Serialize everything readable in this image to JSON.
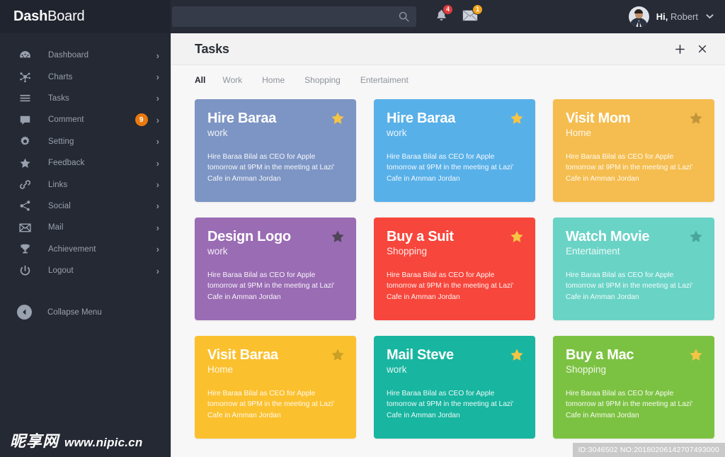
{
  "brand": {
    "bold": "Dash",
    "light": "Board"
  },
  "search": {
    "value": "",
    "placeholder": "",
    "icon": "search-icon"
  },
  "notifications": {
    "bell": {
      "icon": "bell-icon",
      "count": "4",
      "color": "#e03b3b"
    },
    "mail": {
      "icon": "envelope-icon",
      "count": "1",
      "color": "#f0a41e"
    }
  },
  "profile": {
    "greeting": "Hi,",
    "name": "Robert",
    "caret": "⌵",
    "avatar_alt": "avatar"
  },
  "sidebar": {
    "items": [
      {
        "label": "Dashboard",
        "icon": "gauge-icon",
        "chevron": "›",
        "badge": null
      },
      {
        "label": "Charts",
        "icon": "network-icon",
        "chevron": "›",
        "badge": null
      },
      {
        "label": "Tasks",
        "icon": "list-icon",
        "chevron": "›",
        "badge": null
      },
      {
        "label": "Comment",
        "icon": "comment-icon",
        "chevron": "›",
        "badge": "9"
      },
      {
        "label": "Setting",
        "icon": "gear-icon",
        "chevron": "›",
        "badge": null
      },
      {
        "label": "Feedback",
        "icon": "star-icon",
        "chevron": "›",
        "badge": null
      },
      {
        "label": "Links",
        "icon": "link-icon",
        "chevron": "›",
        "badge": null
      },
      {
        "label": "Social",
        "icon": "share-icon",
        "chevron": "›",
        "badge": null
      },
      {
        "label": "Mail",
        "icon": "envelope-icon",
        "chevron": "›",
        "badge": null
      },
      {
        "label": "Achievement",
        "icon": "trophy-icon",
        "chevron": "›",
        "badge": null
      },
      {
        "label": "Logout",
        "icon": "power-icon",
        "chevron": "›",
        "badge": null
      }
    ],
    "collapse": {
      "label": "Collapse Menu",
      "icon": "chevron-left-circle-icon"
    },
    "badge_color": "#e8790f"
  },
  "panel": {
    "title": "Tasks",
    "add_icon": "plus-icon",
    "close_icon": "close-icon"
  },
  "tabs": [
    {
      "label": "All",
      "active": true
    },
    {
      "label": "Work",
      "active": false
    },
    {
      "label": "Home",
      "active": false
    },
    {
      "label": "Shopping",
      "active": false
    },
    {
      "label": "Entertaiment",
      "active": false
    }
  ],
  "task_body": "Hire Baraa Bilal as CEO for Apple tomorrow at 9PM in the meeting at Lazi' Cafe in Amman Jordan",
  "cards": [
    {
      "title": "Hire Baraa",
      "category": "work",
      "body": "Hire Baraa Bilal as CEO for Apple tomorrow at 9PM in the meeting at Lazi' Cafe in Amman Jordan",
      "bg": "#7d95c4",
      "star": "#f4c councils",
      "star_color": "#f6c444",
      "starred": true
    },
    {
      "title": "Hire Baraa",
      "category": "work",
      "body": "Hire Baraa Bilal as CEO for Apple tomorrow at 9PM in the meeting at Lazi' Cafe in Amman Jordan",
      "bg": "#58b0e8",
      "star_color": "#f6c444",
      "starred": true
    },
    {
      "title": "Visit Mom",
      "category": "Home",
      "body": "Hire Baraa Bilal as CEO for Apple tomorrow at 9PM in the meeting at Lazi' Cafe in Amman Jordan",
      "bg": "#f5bd4f",
      "star_color": "#c3953b",
      "starred": false
    },
    {
      "title": "Design Logo",
      "category": "work",
      "body": "Hire Baraa Bilal as CEO for Apple tomorrow at 9PM in the meeting at Lazi' Cafe in Amman Jordan",
      "bg": "#9a6cb4",
      "star_color": "#4e4456",
      "starred": false
    },
    {
      "title": "Buy a Suit",
      "category": "Shopping",
      "body": "Hire Baraa Bilal as CEO for Apple tomorrow at 9PM in the meeting at Lazi' Cafe in Amman Jordan",
      "bg": "#f7463c",
      "star_color": "#f6c444",
      "starred": true
    },
    {
      "title": "Watch Movie",
      "category": "Entertaiment",
      "body": "Hire Baraa Bilal as CEO for Apple tomorrow at 9PM in the meeting at Lazi' Cafe in Amman Jordan",
      "bg": "#69d3c6",
      "star_color": "#4aa69c",
      "starred": false
    },
    {
      "title": "Visit Baraa",
      "category": "Home",
      "body": "Hire Baraa Bilal as CEO for Apple tomorrow at 9PM in the meeting at Lazi' Cafe in Amman Jordan",
      "bg": "#fbc02e",
      "star_color": "#caa026",
      "starred": false
    },
    {
      "title": "Mail Steve",
      "category": "work",
      "body": "Hire Baraa Bilal as CEO for Apple tomorrow at 9PM in the meeting at Lazi' Cafe in Amman Jordan",
      "bg": "#18b5a0",
      "star_color": "#f6c444",
      "starred": true
    },
    {
      "title": "Buy a Mac",
      "category": "Shopping",
      "body": "Hire Baraa Bilal as CEO for Apple tomorrow at 9PM in the meeting at Lazi' Cafe in Amman Jordan",
      "bg": "#7cc242",
      "star_color": "#f6c444",
      "starred": true
    }
  ],
  "footer": {
    "id_tag": "ID:3046502 NO:20180206142707493000",
    "watermark_cn": "昵享网",
    "watermark_url": "www.nipic.cn"
  }
}
